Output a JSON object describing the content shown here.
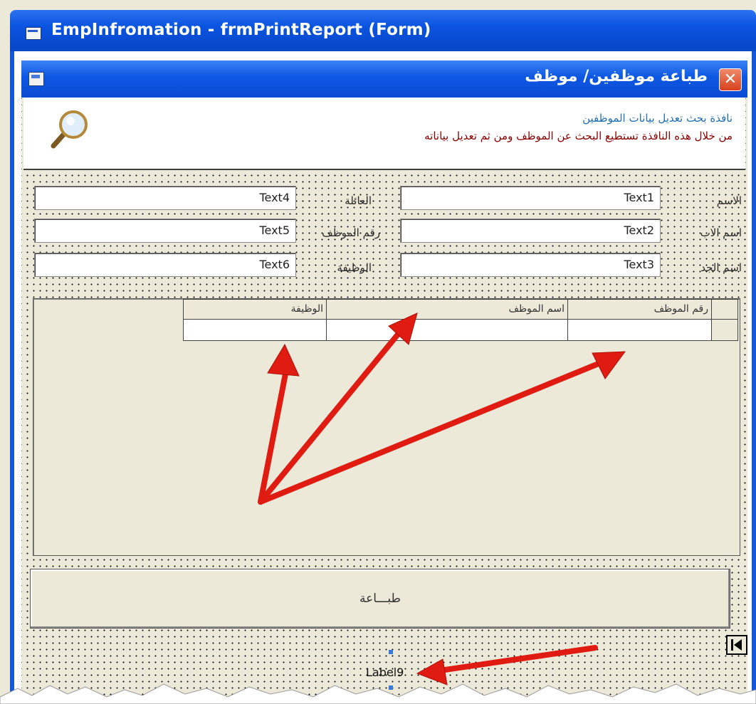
{
  "window": {
    "title": "EmpInfromation - frmPrintReport (Form)"
  },
  "form": {
    "title": "طباعة موظفين/ موظف",
    "close_icon": "close-x-icon",
    "header": {
      "line1": "نافذة بحث تعديل بيانات الموظفين",
      "line2": "من خلال هذه النافذة تستطيع البحث عن الموظف ومن ثم تعديل بياناته",
      "line2_color": "#8b0000",
      "line1_color": "#1f6fb0",
      "icon": "magnifier-icon"
    },
    "fields": {
      "name_label": "الاسم",
      "name_value": "Text1",
      "father_label": "اسم الاب",
      "father_value": "Text2",
      "grandfather_label": "اسم الجد",
      "grandfather_value": "Text3",
      "family_label": "العائلة",
      "family_value": "Text4",
      "emp_no_label": "رقم الموظف",
      "emp_no_value": "Text5",
      "job_label": "الوظيفة",
      "job_value": "Text6"
    },
    "grid": {
      "columns": [
        "رقم الموظف",
        "اسم الموظف",
        "الوظيفة"
      ]
    },
    "print_button": "طبـــاعة",
    "nav_first_icon": "first-record-icon",
    "label9": "Label9"
  },
  "colors": {
    "titlebar": "#0a53e0",
    "form_bg": "#ece9d8",
    "arrow": "#e01b12"
  }
}
